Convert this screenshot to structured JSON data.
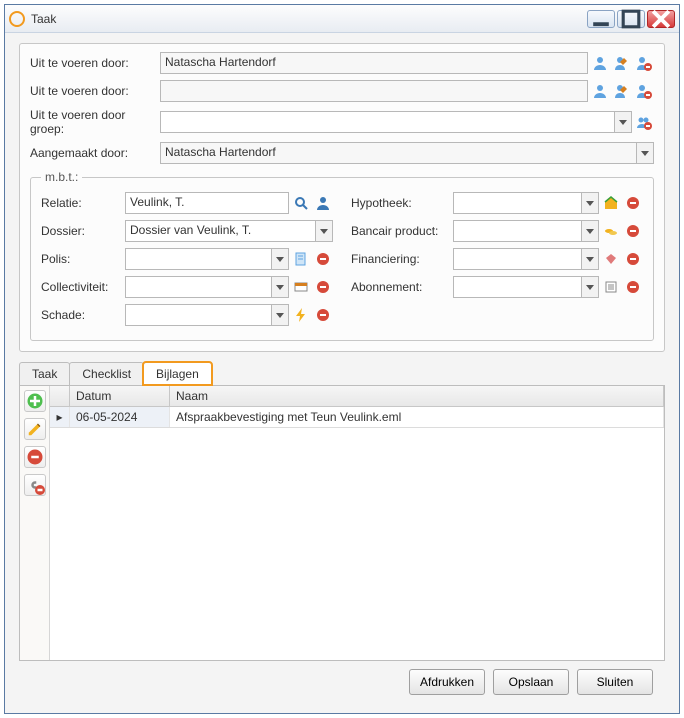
{
  "window": {
    "title": "Taak"
  },
  "section1": {
    "exec_by_label": "Uit te voeren door:",
    "exec_by_value": "Natascha Hartendorf",
    "exec_by2_label": "Uit te voeren door:",
    "exec_by2_value": "",
    "exec_group_label": "Uit te voeren door groep:",
    "exec_group_value": "",
    "created_by_label": "Aangemaakt door:",
    "created_by_value": "Natascha Hartendorf"
  },
  "mbt": {
    "legend": "m.b.t.:",
    "relatie_label": "Relatie:",
    "relatie_value": "Veulink, T.",
    "dossier_label": "Dossier:",
    "dossier_value": "Dossier van Veulink, T.",
    "polis_label": "Polis:",
    "polis_value": "",
    "collectiviteit_label": "Collectiviteit:",
    "collectiviteit_value": "",
    "schade_label": "Schade:",
    "schade_value": "",
    "hypotheek_label": "Hypotheek:",
    "hypotheek_value": "",
    "bancair_label": "Bancair product:",
    "bancair_value": "",
    "financiering_label": "Financiering:",
    "financiering_value": "",
    "abonnement_label": "Abonnement:",
    "abonnement_value": ""
  },
  "tabs": {
    "taak": "Taak",
    "checklist": "Checklist",
    "bijlagen": "Bijlagen"
  },
  "grid": {
    "col_datum": "Datum",
    "col_naam": "Naam",
    "rows": [
      {
        "datum": "06-05-2024",
        "naam": "Afspraakbevestiging met Teun Veulink.eml"
      }
    ]
  },
  "footer": {
    "print": "Afdrukken",
    "save": "Opslaan",
    "close": "Sluiten"
  },
  "icons": {
    "row_marker": "▸"
  }
}
